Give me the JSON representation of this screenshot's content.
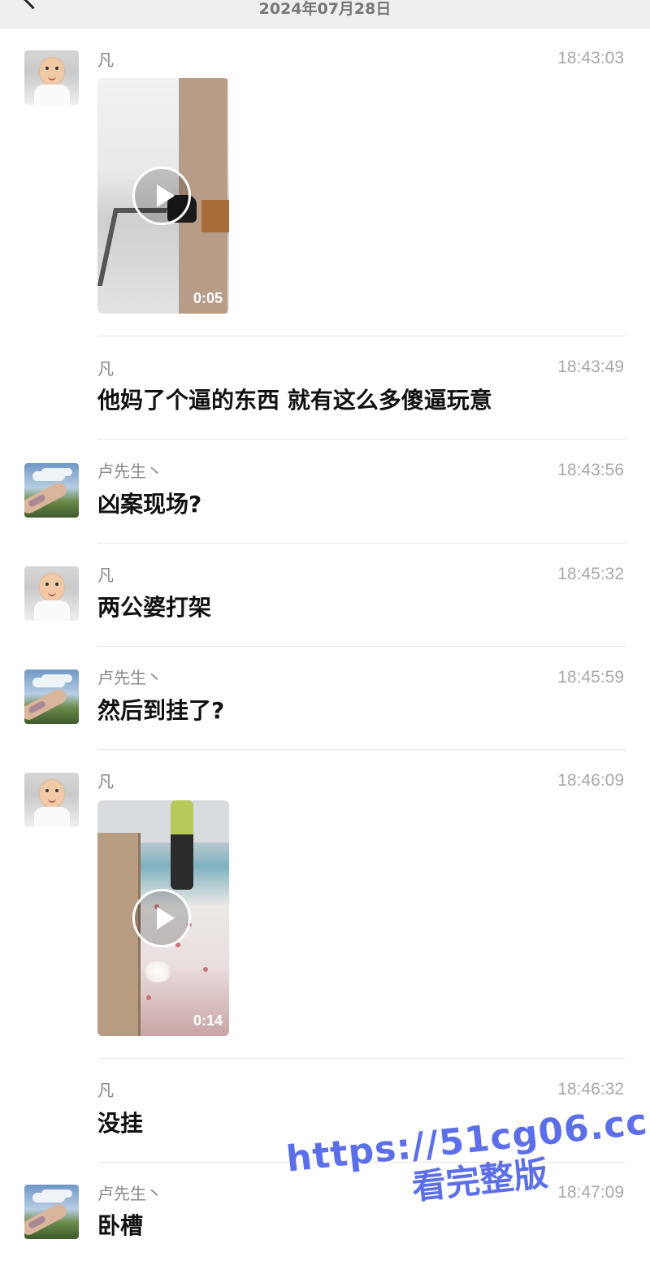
{
  "header": {
    "date": "2024年07月28日",
    "back_icon": "back-chevron-icon"
  },
  "messages": [
    {
      "sender": "凡",
      "time": "18:43:03",
      "type": "video",
      "duration": "0:05",
      "avatar": "baby"
    },
    {
      "sender": "凡",
      "time": "18:43:49",
      "type": "text",
      "text": "他妈了个逼的东西 就有这么多傻逼玩意"
    },
    {
      "sender": "卢先生丶",
      "time": "18:43:56",
      "type": "text",
      "text": "凶案现场?",
      "avatar": "sky"
    },
    {
      "sender": "凡",
      "time": "18:45:32",
      "type": "text",
      "text": "两公婆打架",
      "avatar": "baby"
    },
    {
      "sender": "卢先生丶",
      "time": "18:45:59",
      "type": "text",
      "text": "然后到挂了?",
      "avatar": "sky"
    },
    {
      "sender": "凡",
      "time": "18:46:09",
      "type": "video",
      "duration": "0:14",
      "avatar": "baby"
    },
    {
      "sender": "凡",
      "time": "18:46:32",
      "type": "text",
      "text": "没挂"
    },
    {
      "sender": "卢先生丶",
      "time": "18:47:09",
      "type": "text",
      "text": "卧槽",
      "avatar": "sky"
    }
  ],
  "watermark": {
    "url": "https://51cg06.cc",
    "caption": "看完整版"
  }
}
